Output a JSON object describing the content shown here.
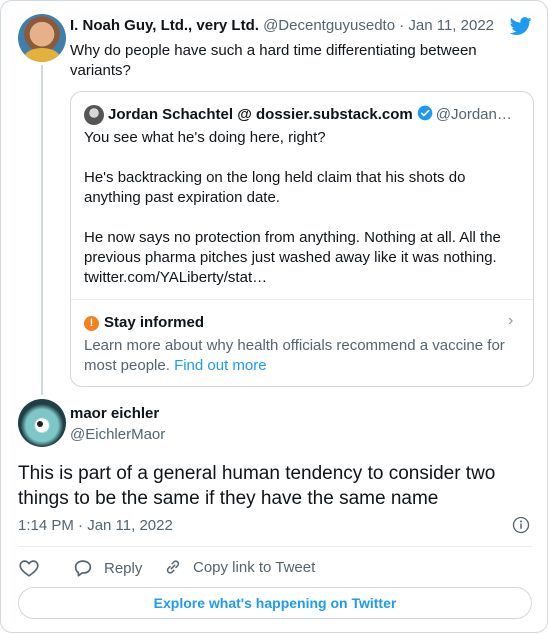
{
  "icons": [
    "twitter-bird-icon",
    "verified-badge-icon",
    "info-icon",
    "chevron-right-icon",
    "heart-icon",
    "reply-icon",
    "link-icon"
  ],
  "colors": {
    "accent": "#1d9bf0",
    "text": "#0f1419",
    "muted": "#536471",
    "warning": "#f4801e"
  },
  "parent_tweet": {
    "author_name": "I. Noah Guy, Ltd., very Ltd.",
    "meta": "@Decentguyusedto · Jan 11, 2022",
    "text": "Why do people have such a hard time differentiating between variants?"
  },
  "quoted_tweet": {
    "author_name": "Jordan Schachtel @ dossier.substack.com",
    "handle": "@Jordan…",
    "paragraphs": [
      "You see what he's doing here, right?",
      "He's backtracking on the long held claim that his shots do anything past expiration date.",
      "He now says no protection from anything. Nothing at all. All the previous pharma pitches just washed away like it was nothing. twitter.com/YALiberty/stat…"
    ],
    "notice": {
      "title": "Stay informed",
      "text": "Learn more about why health officials recommend a vaccine for most people.",
      "link_text": "Find out more"
    }
  },
  "main_tweet": {
    "author_name": "maor eichler",
    "handle": "@EichlerMaor",
    "text": "This is part of a general human tendency to consider two things to be the same if they have the same name",
    "timestamp": "1:14 PM · Jan 11, 2022"
  },
  "actions": {
    "reply_label": "Reply",
    "copy_label": "Copy link to Tweet"
  },
  "explore_label": "Explore what's happening on Twitter"
}
